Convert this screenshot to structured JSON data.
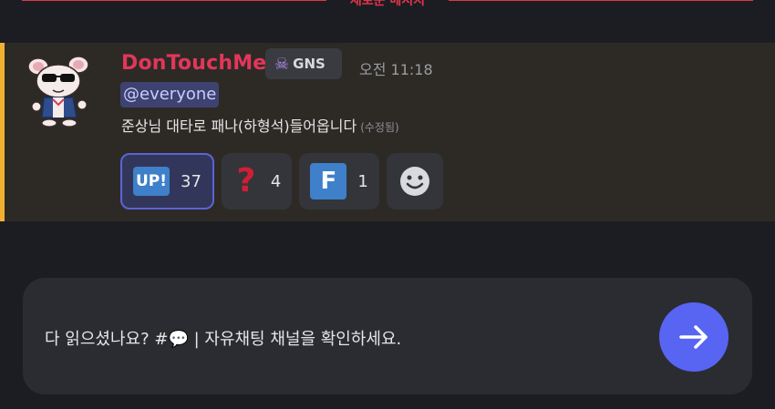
{
  "divider": {
    "label": "새로운 메시지",
    "color": "#e0354a"
  },
  "message": {
    "author": "DonTouchMe",
    "author_color": "#e3365b",
    "guild_tag": {
      "icon": "skull-icon",
      "text": "GNS"
    },
    "timestamp": "오전 11:18",
    "mention": "@everyone",
    "content": "준상님 대타로 패나(하형석)들어옵니다",
    "edited_label": "(수정됨)",
    "highlight_color": "#f0b132",
    "reactions": [
      {
        "emoji": "up-emoji",
        "label": "UP!",
        "count": "37",
        "active": true
      },
      {
        "emoji": "question-emoji",
        "label": "?",
        "count": "4",
        "active": false
      },
      {
        "emoji": "f-emoji",
        "label": "F",
        "count": "1",
        "active": false
      }
    ]
  },
  "composer": {
    "placeholder_before": "다 읽으셨나요? #",
    "placeholder_after": " | 자유채팅 채널을 확인하세요.",
    "channel_icon": "speech-bubble-icon",
    "send_icon": "arrow-right-icon",
    "send_color": "#5865f2"
  }
}
